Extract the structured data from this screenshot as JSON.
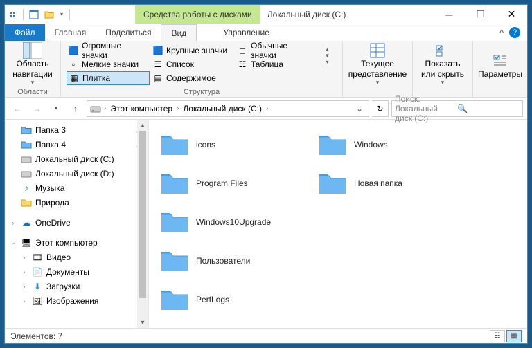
{
  "titlebar": {
    "context_tab": "Средства работы с дисками",
    "title": "Локальный диск (C:)"
  },
  "tabs": {
    "file": "Файл",
    "home": "Главная",
    "share": "Поделиться",
    "view": "Вид",
    "manage": "Управление"
  },
  "ribbon": {
    "panes_group": "Области",
    "nav_pane": "Область навигации",
    "layout_group": "Структура",
    "extra_large": "Огромные значки",
    "large": "Крупные значки",
    "medium": "Обычные значки",
    "small": "Мелкие значки",
    "list": "Список",
    "details": "Таблица",
    "tiles": "Плитка",
    "content": "Содержимое",
    "current_view": "Текущее представление",
    "show_hide": "Показать или скрыть",
    "options": "Параметры"
  },
  "breadcrumb": {
    "this_pc": "Этот компьютер",
    "drive_c": "Локальный диск (C:)"
  },
  "search": {
    "placeholder": "Поиск: Локальный диск (C:)"
  },
  "nav": {
    "folder3": "Папка 3",
    "folder4": "Папка 4",
    "drive_c": "Локальный диск (C:)",
    "drive_d": "Локальный диск (D:)",
    "music": "Музыка",
    "nature": "Природа",
    "onedrive": "OneDrive",
    "this_pc": "Этот компьютер",
    "videos": "Видео",
    "documents": "Документы",
    "downloads": "Загрузки",
    "pictures": "Изображения"
  },
  "folders": {
    "f0": "icons",
    "f1": "Program Files",
    "f2": "Windows10Upgrade",
    "f3": "Пользователи",
    "f4": "PerfLogs",
    "f5": "Windows",
    "f6": "Новая папка"
  },
  "status": {
    "items": "Элементов: 7"
  }
}
